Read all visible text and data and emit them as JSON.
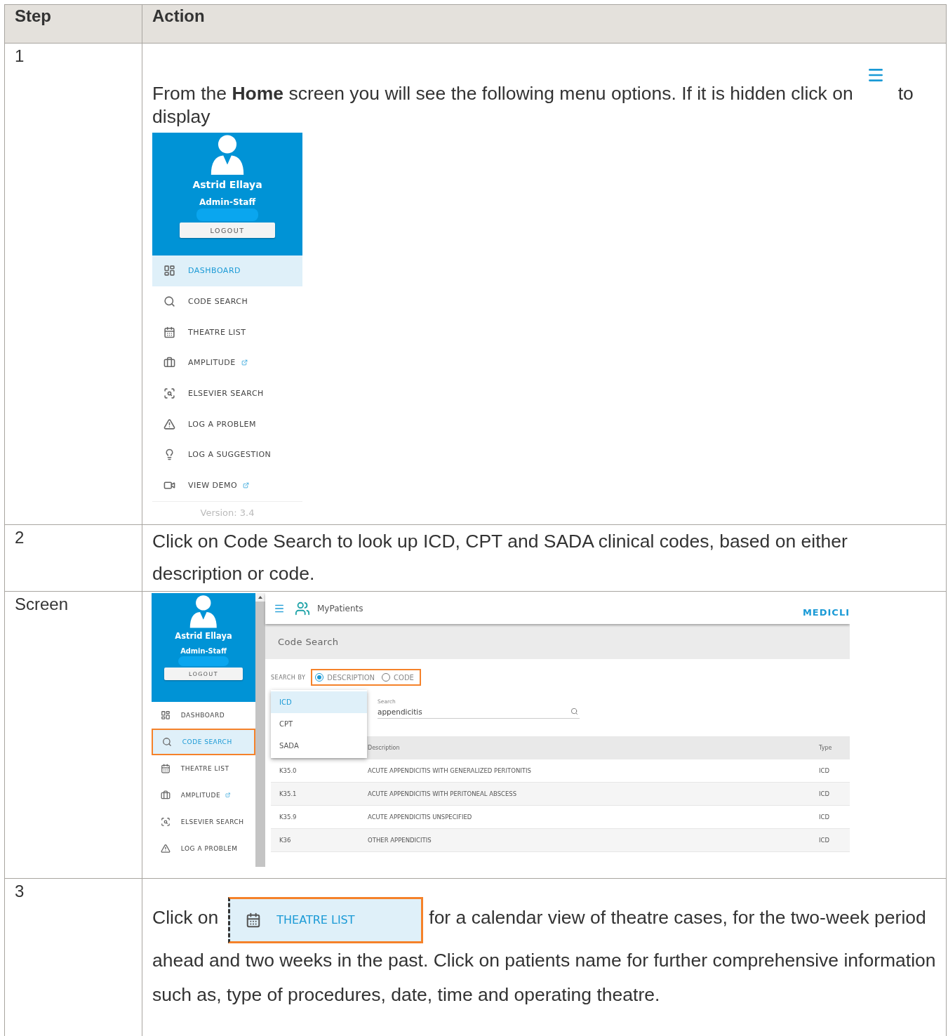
{
  "table": {
    "columns": [
      "Step",
      "Action"
    ],
    "rows": [
      {
        "kind": "menu",
        "step": "1",
        "text": "From the **Home** screen you will see the following menu options. If it is hidden click on",
        "text_after": "to",
        "text_next": "display",
        "menu": {
          "user": "Astrid Ellaya",
          "role": "Admin-Staff",
          "logout": "LOGOUT",
          "version": "Version: 3.4",
          "items": [
            {
              "label": "DASHBOARD",
              "selected": true,
              "external": false
            },
            {
              "label": "CODE SEARCH",
              "selected": false,
              "external": false
            },
            {
              "label": "THEATRE LIST",
              "selected": false,
              "external": false
            },
            {
              "label": "AMPLITUDE",
              "selected": false,
              "external": true
            },
            {
              "label": "ELSEVIER SEARCH",
              "selected": false,
              "external": false
            },
            {
              "label": "LOG A PROBLEM",
              "selected": false,
              "external": false
            },
            {
              "label": "LOG A SUGGESTION",
              "selected": false,
              "external": false
            },
            {
              "label": "VIEW DEMO",
              "selected": false,
              "external": true
            }
          ]
        }
      },
      {
        "kind": "text",
        "step": "2",
        "text": "Click on Code Search to look up ICD, CPT and SADA clinical codes, based on either description or code."
      },
      {
        "kind": "screen",
        "step": "Screen",
        "screen": {
          "sidebar": {
            "user": "Astrid Ellaya",
            "role": "Admin-Staff",
            "logout": "LOGOUT",
            "items": [
              {
                "label": "DASHBOARD",
                "selected": false,
                "external": false,
                "callout": false
              },
              {
                "label": "CODE SEARCH",
                "selected": true,
                "external": false,
                "callout": true
              },
              {
                "label": "THEATRE LIST",
                "selected": false,
                "external": false,
                "callout": false
              },
              {
                "label": "AMPLITUDE",
                "selected": false,
                "external": true,
                "callout": false
              },
              {
                "label": "ELSEVIER SEARCH",
                "selected": false,
                "external": false,
                "callout": false
              },
              {
                "label": "LOG A PROBLEM",
                "selected": false,
                "external": false,
                "callout": false
              }
            ]
          },
          "app_name": "MyPatients",
          "brand": "MEDICLI",
          "page_title": "Code Search",
          "search_by": {
            "label": "SEARCH BY",
            "callout": true,
            "options": [
              {
                "label": "DESCRIPTION",
                "selected": true
              },
              {
                "label": "CODE",
                "selected": false
              }
            ]
          },
          "type_options": [
            {
              "label": "ICD",
              "selected": true
            },
            {
              "label": "CPT",
              "selected": false
            },
            {
              "label": "SADA",
              "selected": false
            }
          ],
          "search": {
            "label": "Search",
            "value": "appendicitis"
          },
          "results": {
            "columns": [
              "Description",
              "Type"
            ],
            "rows": [
              {
                "code": "K35.0",
                "description": "ACUTE APPENDICITIS WITH GENERALIZED PERITONITIS",
                "type": "ICD"
              },
              {
                "code": "K35.1",
                "description": "ACUTE APPENDICITIS WITH PERITONEAL ABSCESS",
                "type": "ICD"
              },
              {
                "code": "K35.9",
                "description": "ACUTE APPENDICITIS UNSPECIFIED",
                "type": "ICD"
              },
              {
                "code": "K36",
                "description": "OTHER APPENDICITIS",
                "type": "ICD"
              }
            ]
          }
        }
      },
      {
        "kind": "button",
        "step": "3",
        "text": "Click on",
        "button": {
          "label": "THEATRE LIST",
          "callout": true
        },
        "text_after": "for a calendar view of theatre cases, for the two-week period",
        "text_next": "ahead and two weeks in the past. Click on patients name for further comprehensive information such as, type of procedures, date, time and operating theatre."
      }
    ]
  }
}
